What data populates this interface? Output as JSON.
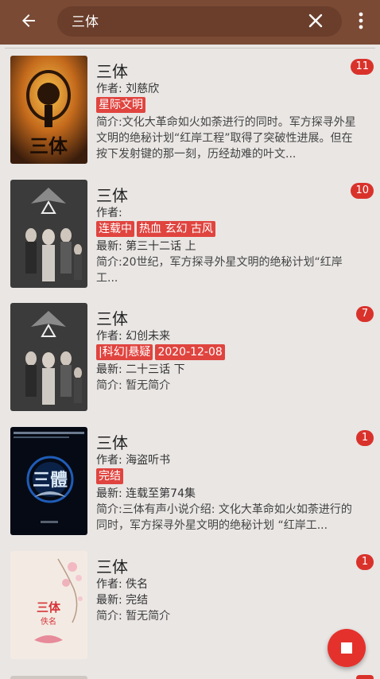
{
  "toolbar": {
    "query": "三体",
    "accent": "#7a4a35"
  },
  "results": [
    {
      "title": "三体",
      "author": "作者: 刘慈欣",
      "tags": [
        "星际文明"
      ],
      "latest": "",
      "intro": "简介:文化大革命如火如荼进行的同时。军方探寻外星文明的绝秘计划“红岸工程”取得了突破性进展。但在按下发射键的那一刻，历经劫难的叶文...",
      "count": "11"
    },
    {
      "title": "三体",
      "author": "作者:",
      "tags": [
        "连载中",
        "热血 玄幻 古风"
      ],
      "latest": "最新: 第三十二话 上",
      "intro": "简介:20世纪，军方探寻外星文明的绝秘计划“红岸工...",
      "count": "10"
    },
    {
      "title": "三体",
      "author": "作者: 幻创未来",
      "tags": [
        "|科幻|悬疑",
        "2020-12-08"
      ],
      "latest": "最新: 二十三话 下",
      "intro": "简介: 暂无简介",
      "count": "7"
    },
    {
      "title": "三体",
      "author": "作者: 海盗听书",
      "tags": [
        "完结"
      ],
      "latest": "最新: 连载至第74集",
      "intro": "简介:三体有声小说介绍: 文化大革命如火如荼进行的同时，军方探寻外星文明的绝秘计划 “红岸工...",
      "count": "1"
    },
    {
      "title": "三体",
      "author": "作者: 佚名",
      "tags": [],
      "latest": "最新: 完结",
      "intro": "简介: 暂无简介",
      "count": "1"
    }
  ],
  "cover_texts": {
    "c3": "三體",
    "c5_title": "三体",
    "c5_sub": "佚名"
  },
  "icons": {
    "back": "arrow-left-icon",
    "clear": "close-icon",
    "more": "more-vert-icon",
    "fab": "stop-icon"
  }
}
